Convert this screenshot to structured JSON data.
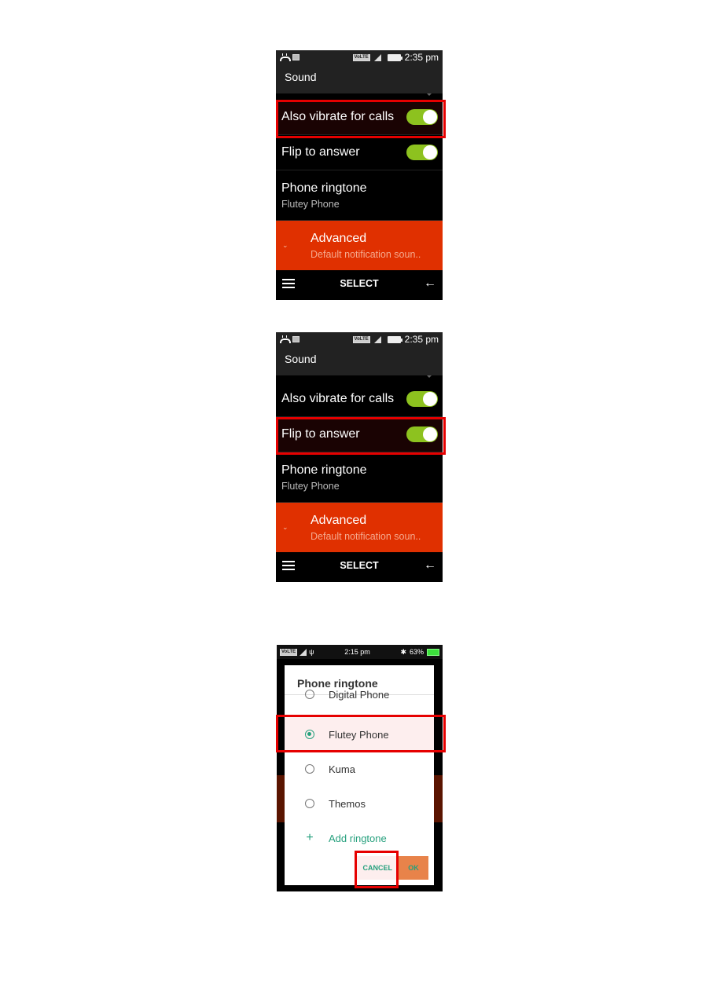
{
  "screens": [
    {
      "status_bar": {
        "time": "2:35 pm",
        "network_label": "VoLTE",
        "icons": [
          "missed-call-icon",
          "image-icon",
          "volte-icon",
          "signal-icon",
          "battery-icon"
        ]
      },
      "app_bar": {
        "title": "Sound"
      },
      "settings": [
        {
          "label": "Also vibrate for calls",
          "toggle_on": true
        },
        {
          "label": "Flip to answer",
          "toggle_on": true
        }
      ],
      "ringtone": {
        "label": "Phone ringtone",
        "value": "Flutey Phone"
      },
      "advanced": {
        "title": "Advanced",
        "subtitle": "Default notification soun..",
        "icon": "chevron-down-icon"
      },
      "softkeys": {
        "left_icon": "menu-icon",
        "center": "SELECT",
        "right_icon": "back-arrow-icon",
        "right_glyph": "←"
      },
      "highlighted": "Also vibrate for calls"
    },
    {
      "status_bar": {
        "time": "2:35 pm",
        "network_label": "VoLTE",
        "icons": [
          "missed-call-icon",
          "image-icon",
          "volte-icon",
          "signal-icon",
          "battery-icon"
        ]
      },
      "app_bar": {
        "title": "Sound"
      },
      "settings": [
        {
          "label": "Also vibrate for calls",
          "toggle_on": true
        },
        {
          "label": "Flip to answer",
          "toggle_on": true
        }
      ],
      "ringtone": {
        "label": "Phone ringtone",
        "value": "Flutey Phone"
      },
      "advanced": {
        "title": "Advanced",
        "subtitle": "Default notification soun..",
        "icon": "chevron-down-icon"
      },
      "softkeys": {
        "left_icon": "menu-icon",
        "center": "SELECT",
        "right_icon": "back-arrow-icon",
        "right_glyph": "←"
      },
      "highlighted": "Flip to answer"
    },
    {
      "status_bar": {
        "time": "2:15 pm",
        "battery": "63%",
        "network_label": "VoLTE",
        "icons": [
          "volte-icon",
          "signal-icon",
          "usb-icon",
          "bluetooth-icon",
          "vibrate-icon",
          "battery-charging-icon"
        ]
      },
      "dialog": {
        "title": "Phone ringtone",
        "options": [
          {
            "label": "Digital Phone",
            "selected": false
          },
          {
            "label": "Flutey Phone",
            "selected": true
          },
          {
            "label": "Kuma",
            "selected": false
          },
          {
            "label": "Themos",
            "selected": false
          }
        ],
        "add_label": "Add ringtone",
        "add_glyph": "+",
        "cancel_label": "CANCEL",
        "ok_label": "OK"
      },
      "highlighted": [
        "Flutey Phone",
        "CANCEL"
      ]
    }
  ],
  "colors": {
    "toggle_on": "#8dc21f",
    "advanced_bg": "#e03000",
    "highlight_box": "#e60000",
    "dialog_accent": "#26a07d",
    "ok_button_bg": "#e8834a"
  }
}
